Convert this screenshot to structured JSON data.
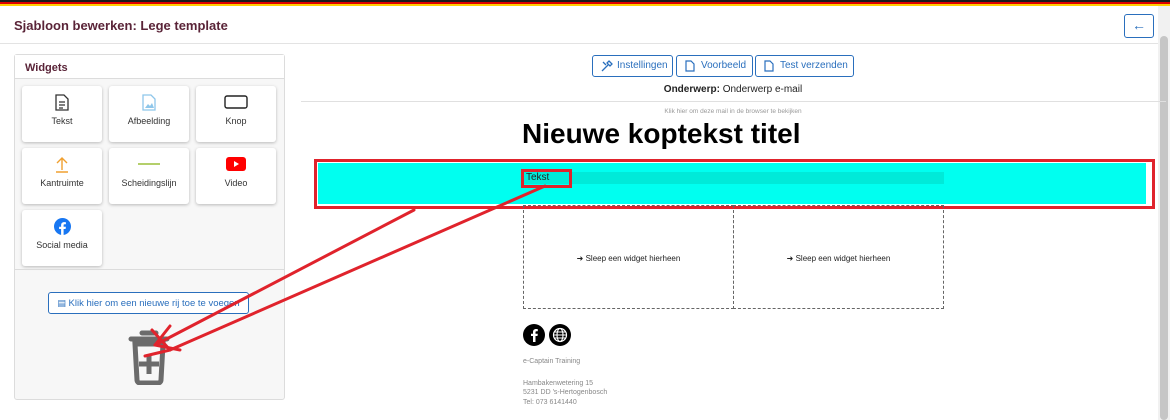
{
  "header": {
    "title": "Sjabloon bewerken: Lege template",
    "back_icon": "arrow-left-icon"
  },
  "colors": {
    "accent": "#2a6fbd",
    "title": "#5a2438",
    "highlight": "#00fff0",
    "annotation": "#e0232c",
    "flag": [
      "#000000",
      "#dd0000",
      "#ffce00"
    ]
  },
  "widgets": {
    "title": "Widgets",
    "items": [
      {
        "label": "Tekst",
        "icon": "document-icon"
      },
      {
        "label": "Afbeelding",
        "icon": "image-icon"
      },
      {
        "label": "Knop",
        "icon": "button-icon"
      },
      {
        "label": "Kantruimte",
        "icon": "spacer-icon"
      },
      {
        "label": "Scheidingslijn",
        "icon": "divider-icon"
      },
      {
        "label": "Video",
        "icon": "youtube-icon"
      },
      {
        "label": "Social media",
        "icon": "facebook-icon"
      }
    ],
    "add_row_label": "Klik hier om een nieuwe rij toe te voegen",
    "trash_icon": "trash-icon"
  },
  "toolbar": {
    "settings": "Instellingen",
    "preview": "Voorbeeld",
    "test_send": "Test verzenden"
  },
  "subject": {
    "label": "Onderwerp:",
    "value": "Onderwerp e-mail"
  },
  "email": {
    "browser_link": "Klik hier om deze mail in de browser te bekijken",
    "headline": "Nieuwe koptekst titel",
    "text_widget": "Tekst",
    "dropzone_label": "Sleep een widget hierheen",
    "company": "e-Captain Training",
    "address1": "Hambakenwetering 15",
    "address2": "5231 DD 's-Hertogenbosch",
    "phone": "Tel: 073 6141440"
  }
}
